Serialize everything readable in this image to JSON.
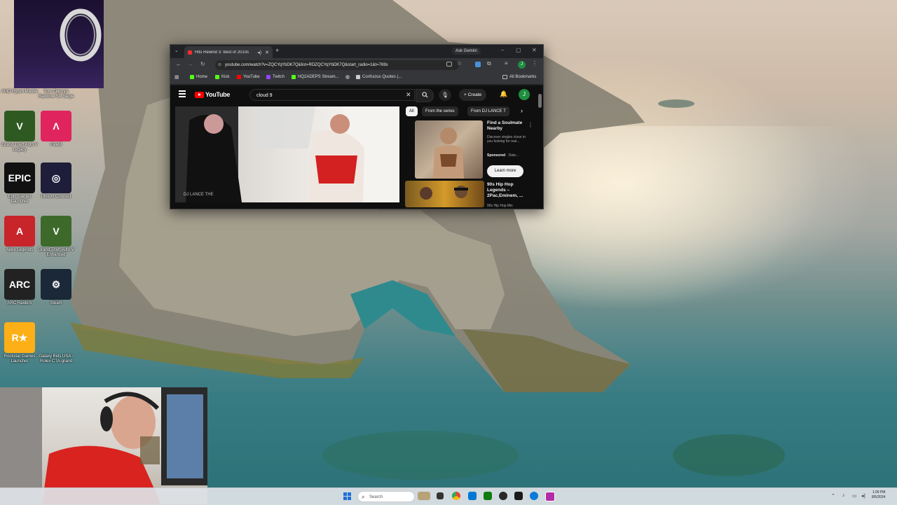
{
  "browser": {
    "tab_title": "Hits Rewind 3: Best of 2010s",
    "new_tab": "+",
    "gemini": "Ask Gemini",
    "url": "youtube.com/watch?v=ZQCYqYbDK7Q&list=RDZQCYqYbDK7Q&start_radio=1&t=769s",
    "bookmarks": [
      "Home",
      "Kick",
      "YouTube",
      "Twitch",
      "HQ2ADEPS Stream...",
      "Confucius Quotes (..."
    ],
    "all_bookmarks": "All Bookmarks",
    "profile_initial": "J"
  },
  "youtube": {
    "logo_text": "YouTube",
    "search_value": "cloud 9",
    "create_label": "Create",
    "avatar_initial": "J",
    "video_watermark": "DJ LANCE THE",
    "chips": [
      "All",
      "From the series",
      "From DJ LANCE T"
    ],
    "ad": {
      "title": "Find a Soulmate Nearby",
      "description": "Discover singles close to you looking for real...",
      "sponsored": "Sponsored",
      "advertiser": "· Date...",
      "button": "Learn more"
    },
    "rec": {
      "title": "90s Hip Hop Legends – 2Pac,Eminem, ...",
      "channel": "90s Hip Hop Mix"
    }
  },
  "desktop_icons": [
    {
      "label": "AMD Ryzen Master",
      "color": "#1a1a1a",
      "glyph": ""
    },
    {
      "label": "Tom Clancy's Rainbow Six Siege",
      "color": "#1a1a1a",
      "glyph": ""
    },
    {
      "label": "Grand Theft Auto V Legacy",
      "color": "#2e5a22",
      "glyph": "V"
    },
    {
      "label": "FiveM",
      "color": "#e0245e",
      "glyph": "Λ"
    },
    {
      "label": "Epic Games Launcher",
      "color": "#111111",
      "glyph": "EPIC"
    },
    {
      "label": "Ubisoft Connect",
      "color": "#1e1e3a",
      "glyph": "◎"
    },
    {
      "label": "Apex Legends",
      "color": "#c8252b",
      "glyph": "A"
    },
    {
      "label": "Grand Theft Auto V Enhanced",
      "color": "#3d6a2a",
      "glyph": "V"
    },
    {
      "label": "ARC Raiders",
      "color": "#222222",
      "glyph": "ARC"
    },
    {
      "label": "Steam",
      "color": "#1b2838",
      "glyph": "⚙"
    },
    {
      "label": "Rockstar Games Launcher",
      "color": "#fcaf17",
      "glyph": "R★"
    },
    {
      "label": "Galaxy Bids USA - Rolex CTA-grand",
      "color": "#1a1038",
      "glyph": ""
    }
  ],
  "taskbar": {
    "search_placeholder": "Search",
    "time": "1:09 PM",
    "date": "8/5/2024"
  },
  "colors": {
    "youtube_red": "#ff0000",
    "chrome_dark": "#35363a",
    "taskbar": "#dee2e6"
  }
}
